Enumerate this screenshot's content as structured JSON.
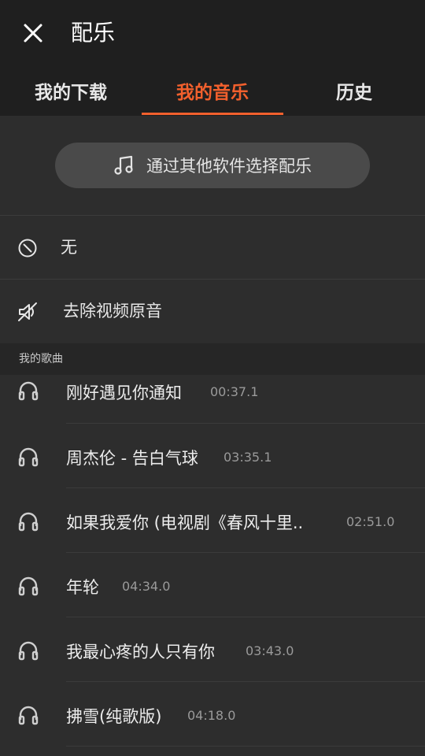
{
  "header": {
    "title": "配乐"
  },
  "tabs": [
    {
      "label": "我的下载"
    },
    {
      "label": "我的音乐"
    },
    {
      "label": "历史"
    }
  ],
  "pick_button": {
    "label": "通过其他软件选择配乐"
  },
  "options": {
    "none": "无",
    "remove_audio": "去除视频原音"
  },
  "section": {
    "title": "我的歌曲"
  },
  "songs": [
    {
      "name": "刚好遇见你通知",
      "duration": "00:37.1"
    },
    {
      "name": "周杰伦 - 告白气球",
      "duration": "03:35.1"
    },
    {
      "name": "如果我爱你 (电视剧《春风十里..",
      "duration": "02:51.0"
    },
    {
      "name": "年轮",
      "duration": "04:34.0"
    },
    {
      "name": "我最心疼的人只有你",
      "duration": "03:43.0"
    },
    {
      "name": "拂雪(纯歌版)",
      "duration": "04:18.0"
    }
  ],
  "colors": {
    "accent": "#f2602d",
    "background": "#2d2d2d",
    "topbar": "#1f1f1f"
  },
  "icons": [
    "close-icon",
    "music-note-icon",
    "ban-icon",
    "mute-icon",
    "headphones-icon"
  ]
}
